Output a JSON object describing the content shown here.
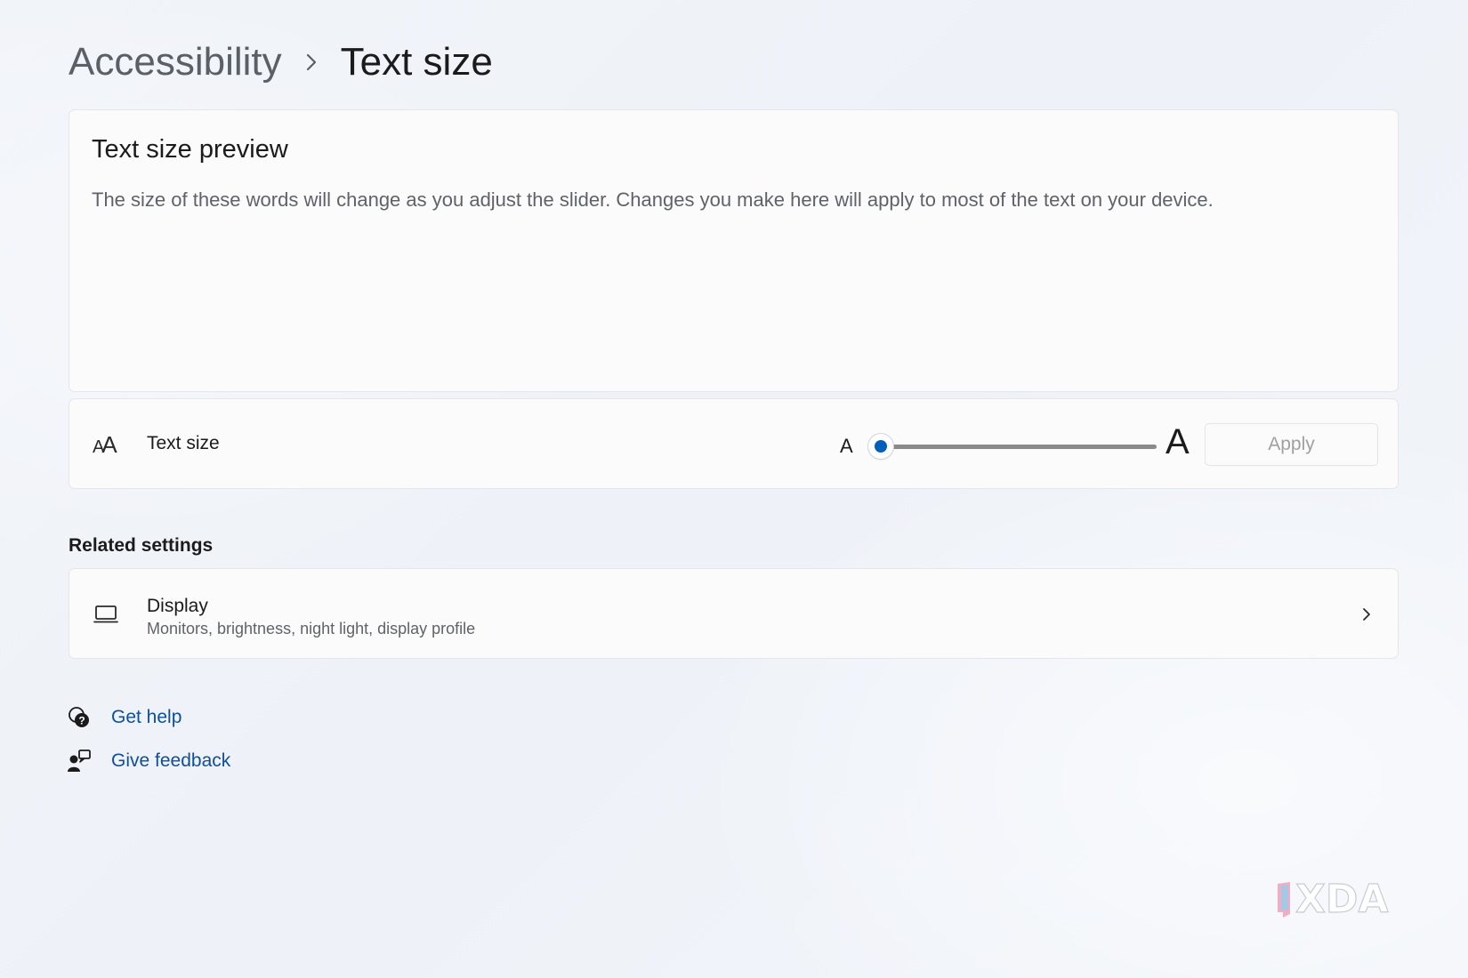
{
  "breadcrumb": {
    "parent": "Accessibility",
    "separator": "›",
    "current": "Text size"
  },
  "preview": {
    "title": "Text size preview",
    "text": "The size of these words will change as you adjust the slider. Changes you make here will apply to most of the text on your device."
  },
  "text_size_setting": {
    "icon": "font-size-icon",
    "icon_glyph_small": "A",
    "icon_glyph_large": "A",
    "label": "Text size",
    "slider_min_glyph": "A",
    "slider_max_glyph": "A",
    "slider_value_fraction": 0.0,
    "apply_label": "Apply",
    "apply_enabled": false
  },
  "related_settings": {
    "title": "Related settings",
    "items": [
      {
        "icon": "laptop-icon",
        "title": "Display",
        "subtitle": "Monitors, brightness, night light, display profile"
      }
    ]
  },
  "help_links": {
    "get_help": "Get help",
    "give_feedback": "Give feedback"
  },
  "colors": {
    "accent": "#005fb8",
    "link": "#0f4f99",
    "background": "#eff3f9",
    "card": "#fbfbfc"
  },
  "watermark": {
    "text": "XDA"
  }
}
